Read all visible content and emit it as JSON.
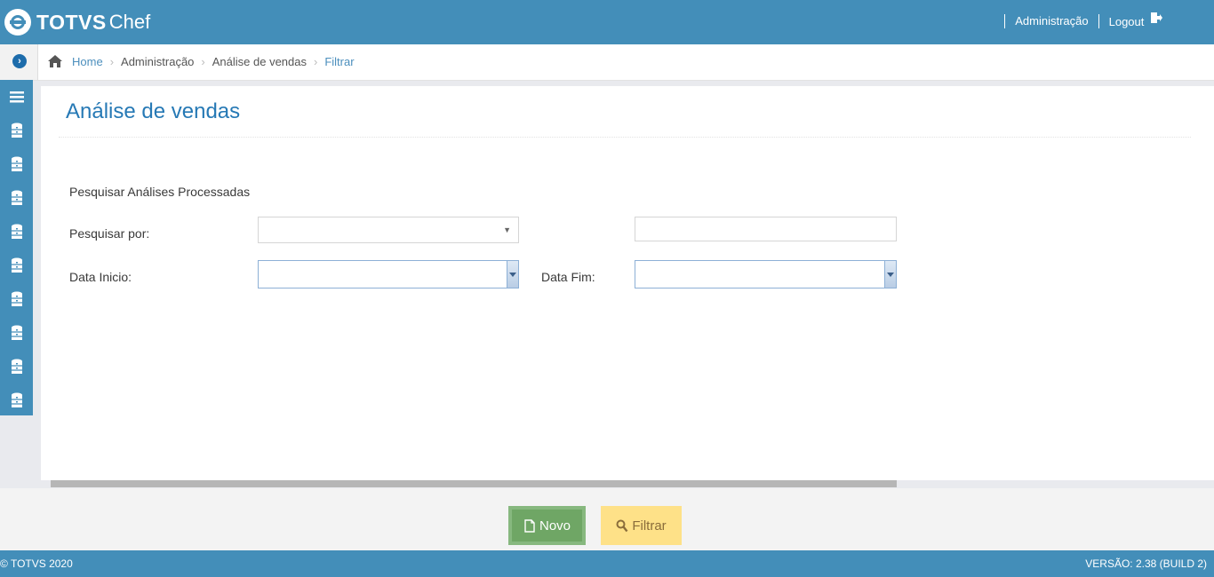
{
  "header": {
    "brand": "TOTVS",
    "product": "Chef",
    "links": [
      "Administração",
      "Logout"
    ]
  },
  "breadcrumb": [
    "Home",
    "Administração",
    "Análise de vendas",
    "Filtrar"
  ],
  "sidebar": {
    "items": [
      "menu-icon",
      "database-icon",
      "database-icon",
      "database-icon",
      "database-icon",
      "database-icon",
      "database-icon",
      "database-icon",
      "database-icon",
      "database-icon"
    ]
  },
  "page": {
    "title": "Análise de vendas",
    "section": "Pesquisar Análises Processadas",
    "search_by_label": "Pesquisar por:",
    "search_by_value": "",
    "search_text_value": "",
    "start_date_label": "Data Inicio:",
    "start_date_value": "",
    "end_date_label": "Data Fim:",
    "end_date_value": ""
  },
  "toolbar": {
    "new_label": "Novo",
    "filter_label": "Filtrar"
  },
  "footer": {
    "copyright": "© TOTVS 2020",
    "version": "VERSÃO: 2.38 (BUILD 2)"
  },
  "colors": {
    "header": "#438eb9",
    "accent": "#2679b5",
    "new_button": "#87b87f",
    "filter_button": "#fee188"
  }
}
